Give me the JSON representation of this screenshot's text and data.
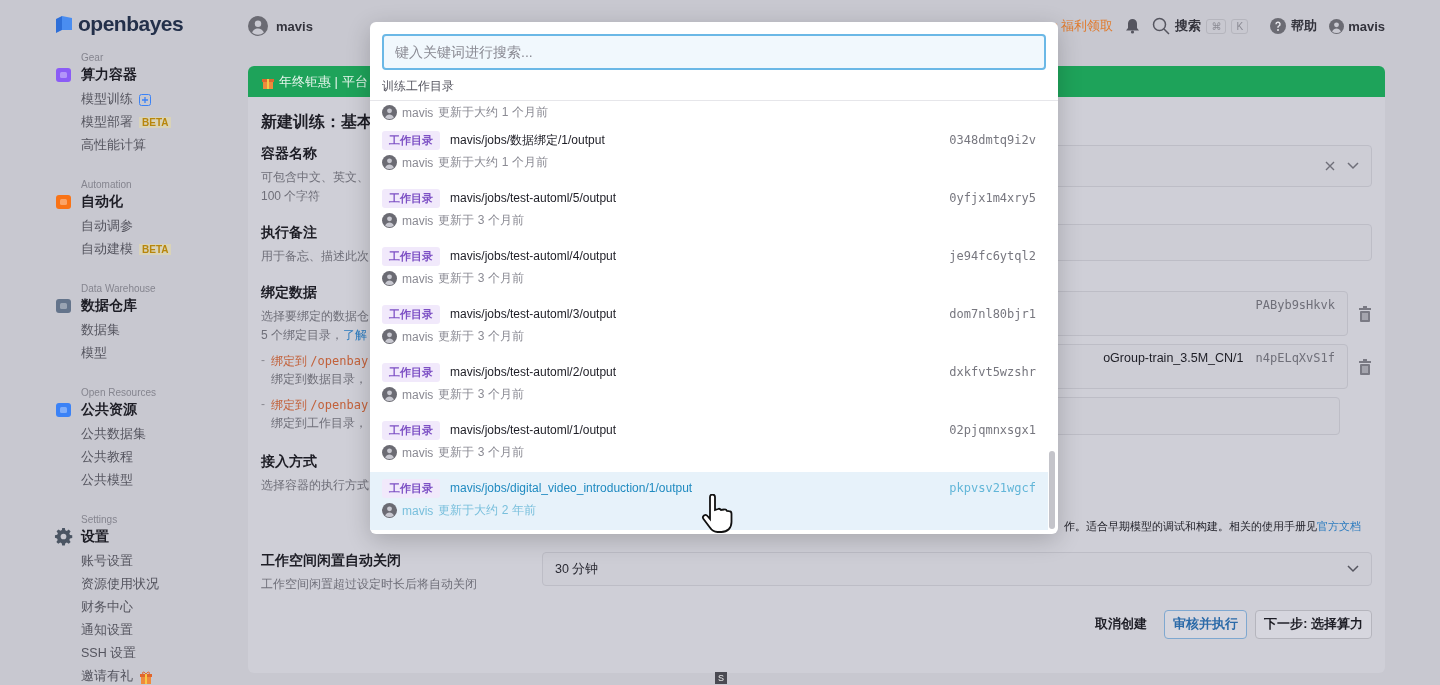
{
  "header": {
    "user": "mavis",
    "promo": "福利领取",
    "search_label": "搜索",
    "shortcut": [
      "⌘",
      "K"
    ],
    "help": "帮助",
    "account": "mavis"
  },
  "sidebar": {
    "logo": "openbayes",
    "sections": [
      {
        "label": "Gear",
        "title": "算力容器",
        "kind": "cube",
        "color": "#8b5cf6",
        "items": [
          {
            "label": "模型训练",
            "kind": "add"
          },
          {
            "label": "模型部署",
            "kind": "plain",
            "badge": "BETA"
          },
          {
            "label": "高性能计算",
            "kind": "plain"
          }
        ]
      },
      {
        "label": "Automation",
        "title": "自动化",
        "kind": "cube",
        "color": "#f97316",
        "items": [
          {
            "label": "自动调参",
            "kind": "plain"
          },
          {
            "label": "自动建模",
            "kind": "plain",
            "badge": "BETA"
          }
        ]
      },
      {
        "label": "Data Warehouse",
        "title": "数据仓库",
        "kind": "cube",
        "color": "#64748b",
        "items": [
          {
            "label": "数据集",
            "kind": "plain"
          },
          {
            "label": "模型",
            "kind": "plain"
          }
        ]
      },
      {
        "label": "Open Resources",
        "title": "公共资源",
        "kind": "cube",
        "color": "#3b82f6",
        "items": [
          {
            "label": "公共数据集",
            "kind": "plain"
          },
          {
            "label": "公共教程",
            "kind": "plain"
          },
          {
            "label": "公共模型",
            "kind": "plain"
          }
        ]
      },
      {
        "label": "Settings",
        "title": "设置",
        "kind": "gear",
        "color": "#4b5563",
        "items": [
          {
            "label": "账号设置",
            "kind": "plain"
          },
          {
            "label": "资源使用状况",
            "kind": "plain"
          },
          {
            "label": "财务中心",
            "kind": "plain"
          },
          {
            "label": "通知设置",
            "kind": "plain"
          },
          {
            "label": "SSH 设置",
            "kind": "plain"
          },
          {
            "label": "邀请有礼",
            "kind": "gift"
          }
        ]
      }
    ]
  },
  "form": {
    "banner": "年终钜惠 | 平台",
    "title": "新建训练：基本",
    "fields": [
      {
        "kind": "select-clear",
        "label": "容器名称",
        "hint": [
          "可包含中文、英文、",
          "100 个字符"
        ]
      },
      {
        "kind": "input",
        "label": "执行备注",
        "hint": [
          "用于备忘、描述此次"
        ]
      },
      {
        "kind": "bindings",
        "label": "绑定数据",
        "hint": [
          "选择要绑定的数据仓"
        ],
        "hint_text": "5 个绑定目录，",
        "hint_link": "了解",
        "bullets": [
          {
            "dash": "-",
            "prefix": "绑定到",
            "path": "/openbay",
            "note": "绑定到数据目录，"
          },
          {
            "dash": "-",
            "prefix": "绑定到",
            "path": "/openbay",
            "note": "绑定到工作目录，"
          }
        ],
        "rows": [
          {
            "id": "PAByb9sHkvk"
          },
          {
            "name": "oGroup-train_3.5M_CN/1",
            "id": "n4pELqXvS1f"
          }
        ]
      },
      {
        "kind": "access",
        "label": "接入方式",
        "hint": [
          "选择容器的执行方式"
        ],
        "note": "作。适合早期模型的调试和构建。相关的使用手册见",
        "link": "官方文档"
      },
      {
        "kind": "select",
        "label": "工作空间闲置自动关闭",
        "hint": [
          "工作空间闲置超过设定时长后将自动关闭"
        ],
        "value": "30 分钟"
      }
    ],
    "buttons": [
      {
        "label": "取消创建",
        "kind": "text"
      },
      {
        "label": "审核并执行",
        "kind": "outline"
      },
      {
        "label": "下一步: 选择算力",
        "kind": "default"
      }
    ]
  },
  "modal": {
    "placeholder": "键入关键词进行搜索...",
    "section": "训练工作目录",
    "items": [
      {
        "user": "mavis",
        "updated": "更新于大约 1 个月前",
        "selected": false
      },
      {
        "tag": "工作目录",
        "path": "mavis/jobs/数据绑定/1/output",
        "id": "0348dmtq9i2v",
        "user": "mavis",
        "updated": "更新于大约 1 个月前",
        "selected": false
      },
      {
        "tag": "工作目录",
        "path": "mavis/jobs/test-automl/5/output",
        "id": "0yfjx1m4xry5",
        "user": "mavis",
        "updated": "更新于 3 个月前",
        "selected": false
      },
      {
        "tag": "工作目录",
        "path": "mavis/jobs/test-automl/4/output",
        "id": "je94fc6ytql2",
        "user": "mavis",
        "updated": "更新于 3 个月前",
        "selected": false
      },
      {
        "tag": "工作目录",
        "path": "mavis/jobs/test-automl/3/output",
        "id": "dom7nl80bjr1",
        "user": "mavis",
        "updated": "更新于 3 个月前",
        "selected": false
      },
      {
        "tag": "工作目录",
        "path": "mavis/jobs/test-automl/2/output",
        "id": "dxkfvt5wzshr",
        "user": "mavis",
        "updated": "更新于 3 个月前",
        "selected": false
      },
      {
        "tag": "工作目录",
        "path": "mavis/jobs/test-automl/1/output",
        "id": "02pjqmnxsgx1",
        "user": "mavis",
        "updated": "更新于 3 个月前",
        "selected": false
      },
      {
        "tag": "工作目录",
        "path": "mavis/jobs/digital_video_introduction/1/output",
        "id": "pkpvsv21wgcf",
        "user": "mavis",
        "updated": "更新于大约 2 年前",
        "selected": true
      }
    ]
  },
  "footer_tag": "S"
}
